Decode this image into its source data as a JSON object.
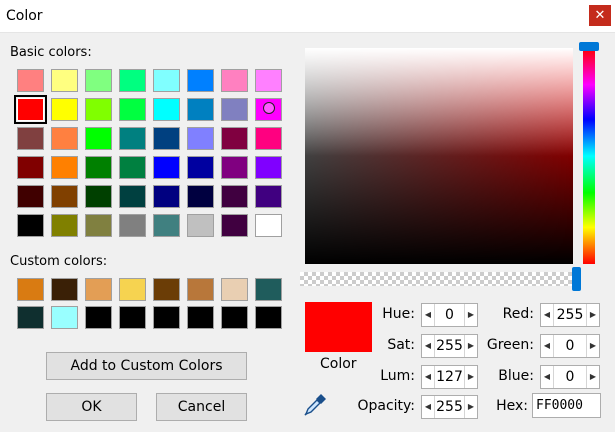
{
  "window": {
    "title": "Color",
    "close_glyph": "✕"
  },
  "basic_colors_label": "Basic colors:",
  "basic_colors": [
    [
      "#ff8080",
      "#ffff80",
      "#80ff80",
      "#00ff80",
      "#80ffff",
      "#0080ff",
      "#ff80c0",
      "#ff80ff"
    ],
    [
      "#ff0000",
      "#ffff00",
      "#80ff00",
      "#00ff40",
      "#00ffff",
      "#0080c0",
      "#8080c0",
      "#ff00ff"
    ],
    [
      "#804040",
      "#ff8040",
      "#00ff00",
      "#008080",
      "#004080",
      "#8080ff",
      "#800040",
      "#ff0080"
    ],
    [
      "#800000",
      "#ff8000",
      "#008000",
      "#008040",
      "#0000ff",
      "#0000a0",
      "#800080",
      "#8000ff"
    ],
    [
      "#400000",
      "#804000",
      "#004000",
      "#004040",
      "#000080",
      "#000040",
      "#400040",
      "#400080"
    ],
    [
      "#000000",
      "#808000",
      "#808040",
      "#808080",
      "#408080",
      "#c0c0c0",
      "#400040",
      "#ffffff"
    ]
  ],
  "custom_colors_label": "Custom colors:",
  "custom_colors": [
    [
      "#d97b12",
      "#3a2006",
      "#e39e55",
      "#f6d350",
      "#6b3d06",
      "#b8773a",
      "#e9cfb2",
      "#1f5c5c"
    ],
    [
      "#0f2f2f",
      "#99ffff",
      "#000000",
      "#000000",
      "#000000",
      "#000000",
      "#000000",
      "#000000"
    ]
  ],
  "buttons": {
    "add_custom": "Add to Custom Colors",
    "ok": "OK",
    "cancel": "Cancel"
  },
  "preview": {
    "label": "Color",
    "color": "#ff0000"
  },
  "fields": {
    "hue": {
      "label": "Hue:",
      "value": "0"
    },
    "sat": {
      "label": "Sat:",
      "value": "255"
    },
    "lum": {
      "label": "Lum:",
      "value": "127"
    },
    "opacity": {
      "label": "Opacity:",
      "value": "255"
    },
    "red": {
      "label": "Red:",
      "value": "255"
    },
    "green": {
      "label": "Green:",
      "value": "0"
    },
    "blue": {
      "label": "Blue:",
      "value": "0"
    },
    "hex": {
      "label": "Hex:",
      "value": "FF0000"
    }
  },
  "spin_arrows": {
    "left": "◀",
    "right": "▶"
  },
  "accent_color": "#0078d7"
}
